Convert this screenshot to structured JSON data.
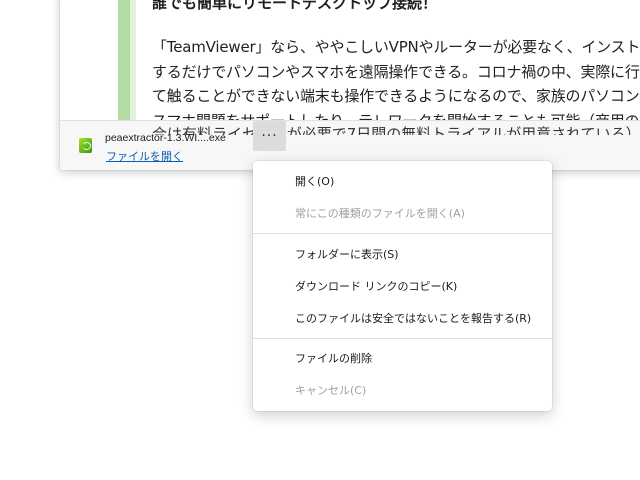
{
  "article": {
    "heading": "誰でも簡単にリモートデスクトップ接続！",
    "lines": [
      "「TeamViewer」なら、ややこしいVPNやルーターが必要なく、インストー",
      "するだけでパソコンやスマホを遠隔操作できる。コロナ禍の中、実際に行",
      "て触ることができない端末も操作できるようになるので、家族のパソコン",
      "スマホ問題をサポートしたり、テレワークを開始することも可能（商用の",
      "合は有料ライセンスが必要で7日間の無料トライアルが用意されている）"
    ]
  },
  "download_bar": {
    "file_name": "peaextractor-1.3.WI....exe",
    "open_link": "ファイルを開く",
    "more_label": "···",
    "file_icon": "peazip-file-icon"
  },
  "context_menu": {
    "items": [
      {
        "label": "開く(O)",
        "enabled": true
      },
      {
        "label": "常にこの種類のファイルを開く(A)",
        "enabled": false
      },
      {
        "label": "フォルダーに表示(S)",
        "enabled": true
      },
      {
        "label": "ダウンロード リンクのコピー(K)",
        "enabled": true
      },
      {
        "label": "このファイルは安全ではないことを報告する(R)",
        "enabled": true
      },
      {
        "label": "ファイルの削除",
        "enabled": true
      },
      {
        "label": "キャンセル(C)",
        "enabled": false
      }
    ]
  },
  "colors": {
    "accent_green": "#b2dca2",
    "link_blue": "#0a5fb4",
    "disabled_text": "#a0a0a0"
  }
}
